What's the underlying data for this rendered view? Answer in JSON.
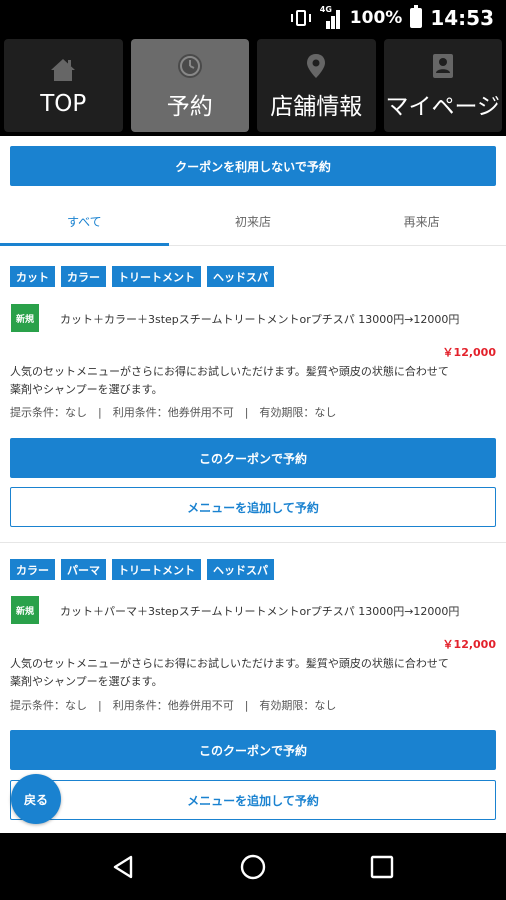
{
  "status_bar": {
    "network": "4G",
    "battery": "100%",
    "time": "14:53"
  },
  "nav": {
    "items": [
      {
        "label": "TOP",
        "icon": "home-icon",
        "active": false
      },
      {
        "label": "予約",
        "icon": "clock-icon",
        "active": true
      },
      {
        "label": "店舗情報",
        "icon": "map-pin-icon",
        "active": false
      },
      {
        "label": "マイページ",
        "icon": "profile-card-icon",
        "active": false
      }
    ]
  },
  "actions": {
    "no_coupon_button": "クーポンを利用しないで予約"
  },
  "tabs": [
    {
      "label": "すべて",
      "active": true
    },
    {
      "label": "初来店",
      "active": false
    },
    {
      "label": "再来店",
      "active": false
    }
  ],
  "coupons": [
    {
      "tags": [
        "カット",
        "カラー",
        "トリートメント",
        "ヘッドスパ"
      ],
      "badge": "新規",
      "title": "カット＋カラー＋3stepスチームトリートメントorプチスパ 13000円→12000円",
      "price": "￥12,000",
      "desc_line1": "人気のセットメニューがさらにお得にお試しいただけます。髪質や頭皮の状態に合わせて",
      "desc_line2": "薬剤やシャンプーを選びます。",
      "conditions": "提示条件：なし　|　利用条件：他券併用不可　|　有効期限：なし",
      "reserve_button": "このクーポンで予約",
      "add_menu_button": "メニューを追加して予約"
    },
    {
      "tags": [
        "カラー",
        "パーマ",
        "トリートメント",
        "ヘッドスパ"
      ],
      "badge": "新規",
      "title": "カット＋パーマ＋3stepスチームトリートメントorプチスパ 13000円→12000円",
      "price": "￥12,000",
      "desc_line1": "人気のセットメニューがさらにお得にお試しいただけます。髪質や頭皮の状態に合わせて",
      "desc_line2": "薬剤やシャンプーを選びます。",
      "conditions": "提示条件：なし　|　利用条件：他券併用不可　|　有効期限：なし",
      "reserve_button": "このクーポンで予約",
      "add_menu_button": "メニューを追加して予約"
    }
  ],
  "back_button": "戻る",
  "colors": {
    "accent": "#1a82d0",
    "new_badge": "#2aa14a",
    "price": "#e3212b",
    "nav_active": "#6b6b6b"
  }
}
